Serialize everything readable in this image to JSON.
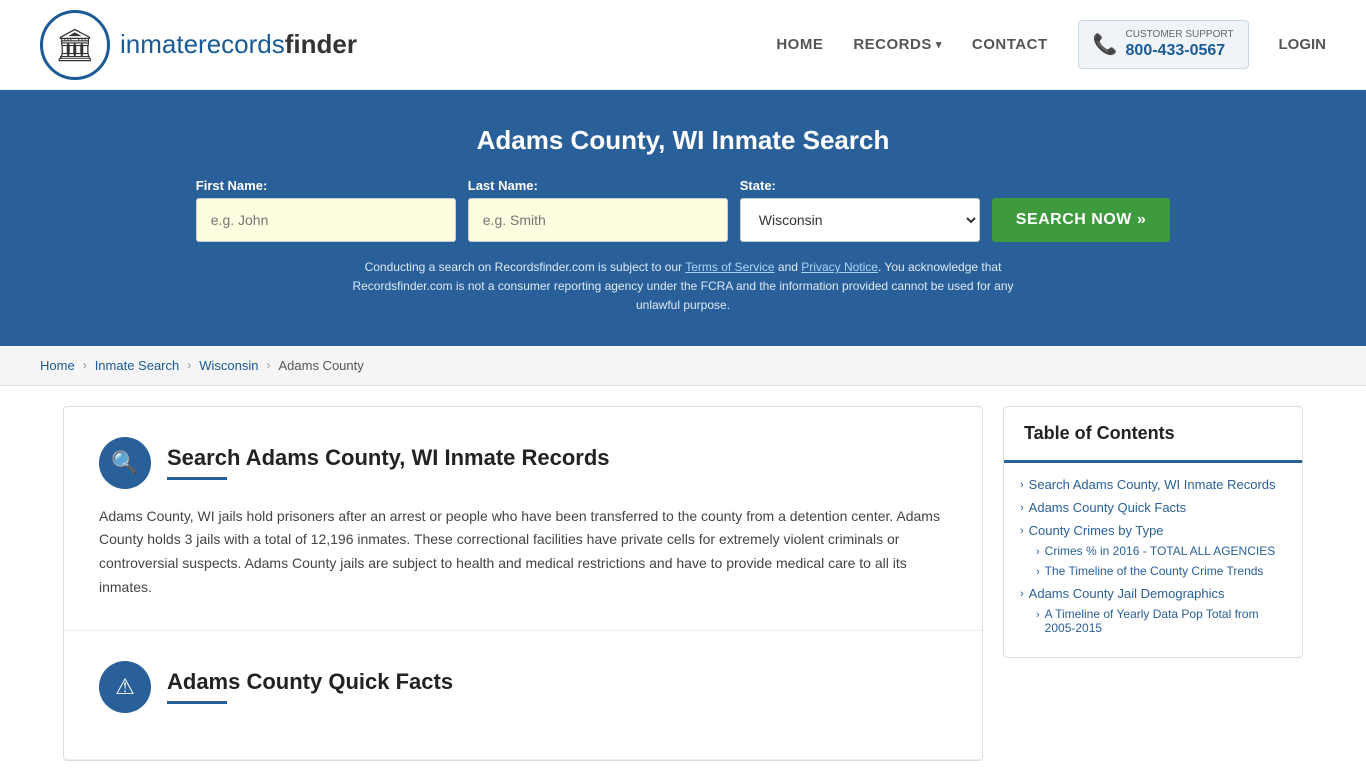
{
  "header": {
    "logo_text_start": "inmaterecords",
    "logo_text_end": "finder",
    "nav": {
      "home": "HOME",
      "records": "RECORDS",
      "contact": "CONTACT",
      "login": "LOGIN"
    },
    "support": {
      "label": "CUSTOMER SUPPORT",
      "number": "800-433-0567"
    }
  },
  "search_banner": {
    "title": "Adams County, WI Inmate Search",
    "first_name_label": "First Name:",
    "first_name_placeholder": "e.g. John",
    "last_name_label": "Last Name:",
    "last_name_placeholder": "e.g. Smith",
    "state_label": "State:",
    "state_value": "Wisconsin",
    "search_button": "SEARCH NOW »",
    "disclaimer": "Conducting a search on Recordsfinder.com is subject to our Terms of Service and Privacy Notice. You acknowledge that Recordsfinder.com is not a consumer reporting agency under the FCRA and the information provided cannot be used for any unlawful purpose."
  },
  "breadcrumb": {
    "items": [
      "Home",
      "Inmate Search",
      "Wisconsin",
      "Adams County"
    ]
  },
  "main": {
    "section1": {
      "icon": "🔍",
      "title": "Search Adams County, WI Inmate Records",
      "body": "Adams County, WI jails hold prisoners after an arrest or people who have been transferred to the county from a detention center. Adams County holds 3 jails with a total of 12,196 inmates. These correctional facilities have private cells for extremely violent criminals or controversial suspects. Adams County jails are subject to health and medical restrictions and have to provide medical care to all its inmates."
    },
    "section2": {
      "icon": "⚠",
      "title": "Adams County Quick Facts"
    }
  },
  "toc": {
    "title": "Table of Contents",
    "items": [
      {
        "label": "Search Adams County, WI Inmate Records",
        "sub": []
      },
      {
        "label": "Adams County Quick Facts",
        "sub": []
      },
      {
        "label": "County Crimes by Type",
        "sub": [
          "Crimes % in 2016 - TOTAL ALL AGENCIES",
          "The Timeline of the County Crime Trends"
        ]
      },
      {
        "label": "Adams County Jail Demographics",
        "sub": [
          "A Timeline of Yearly Data Pop Total from 2005-2015"
        ]
      }
    ]
  }
}
